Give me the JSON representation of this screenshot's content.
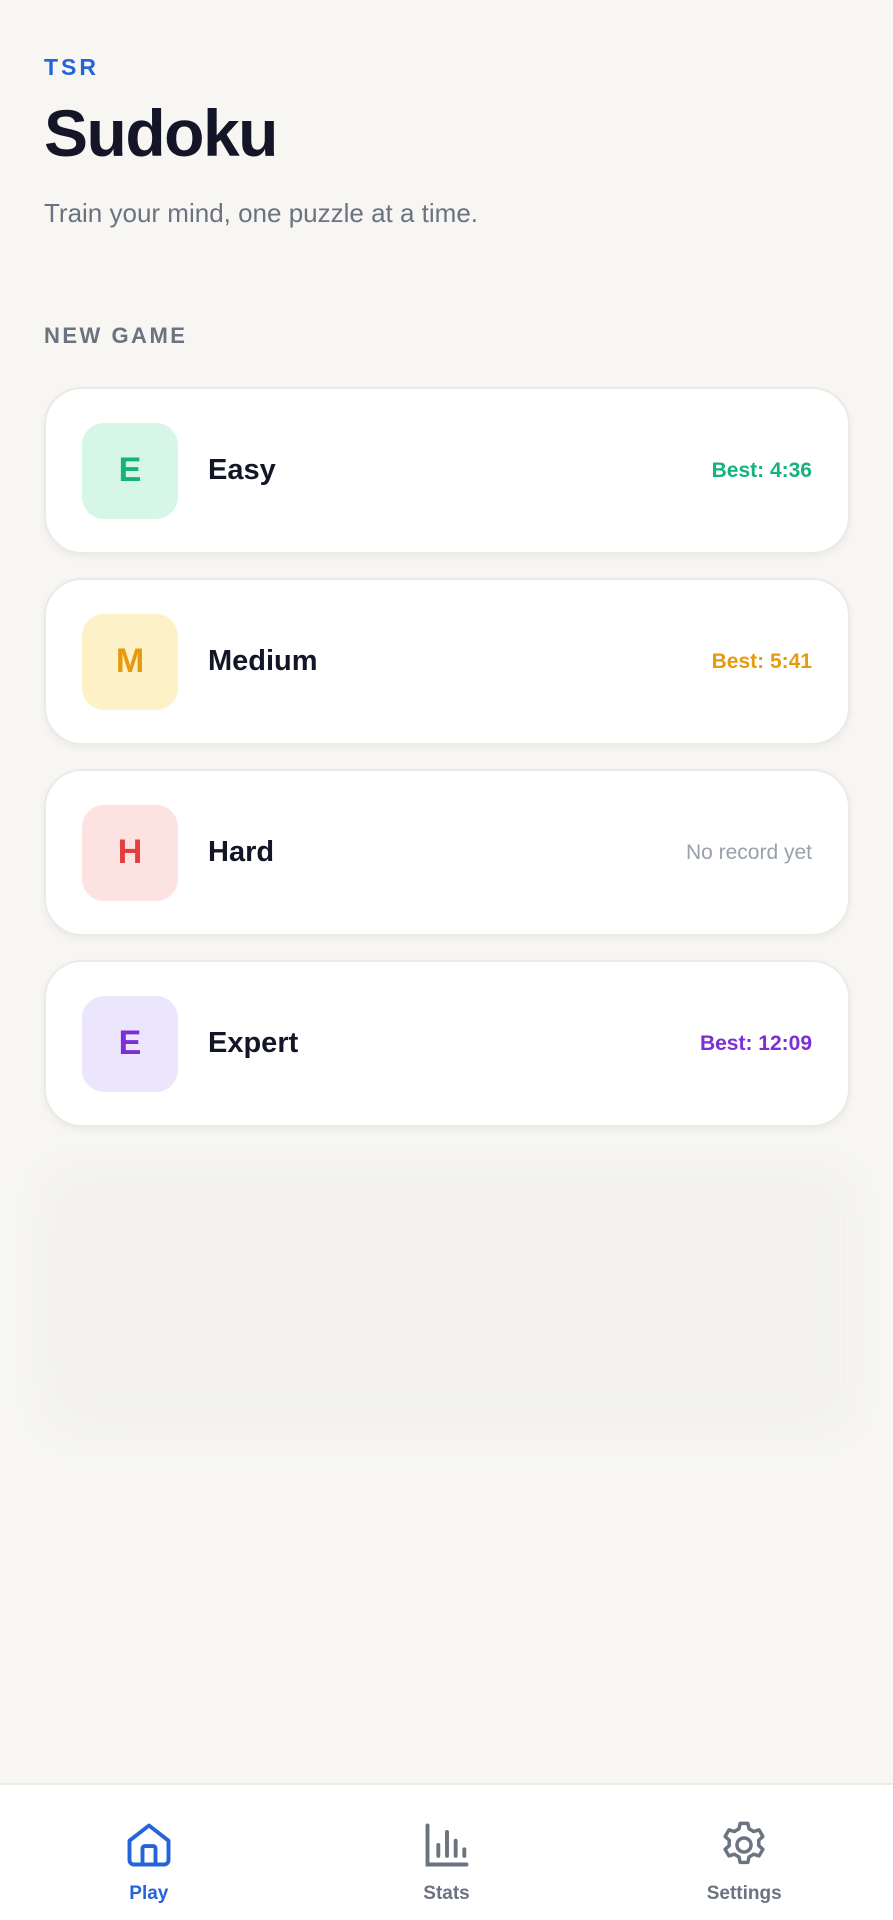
{
  "header": {
    "brand": "TSR",
    "title": "Sudoku",
    "subtitle": "Train your mind, one puzzle at a time."
  },
  "section_label": "NEW GAME",
  "difficulties": [
    {
      "letter": "E",
      "name": "Easy",
      "best": "Best: 4:36",
      "color": "#16b27c",
      "bg": "#d6f7e8"
    },
    {
      "letter": "M",
      "name": "Medium",
      "best": "Best: 5:41",
      "color": "#e79a0d",
      "bg": "#fdf1c8"
    },
    {
      "letter": "H",
      "name": "Hard",
      "best": "No record yet",
      "color": "#e53e3e",
      "bg": "#fde2e2"
    },
    {
      "letter": "E",
      "name": "Expert",
      "best": "Best: 12:09",
      "color": "#7b2fd4",
      "bg": "#ece6fd"
    }
  ],
  "tabs": [
    {
      "label": "Play",
      "icon": "home-icon",
      "active": true
    },
    {
      "label": "Stats",
      "icon": "bar-chart-icon",
      "active": false
    },
    {
      "label": "Settings",
      "icon": "gear-icon",
      "active": false
    }
  ],
  "colors": {
    "accent": "#2563d9",
    "background": "#f7f6f3",
    "muted": "#6b7280"
  }
}
